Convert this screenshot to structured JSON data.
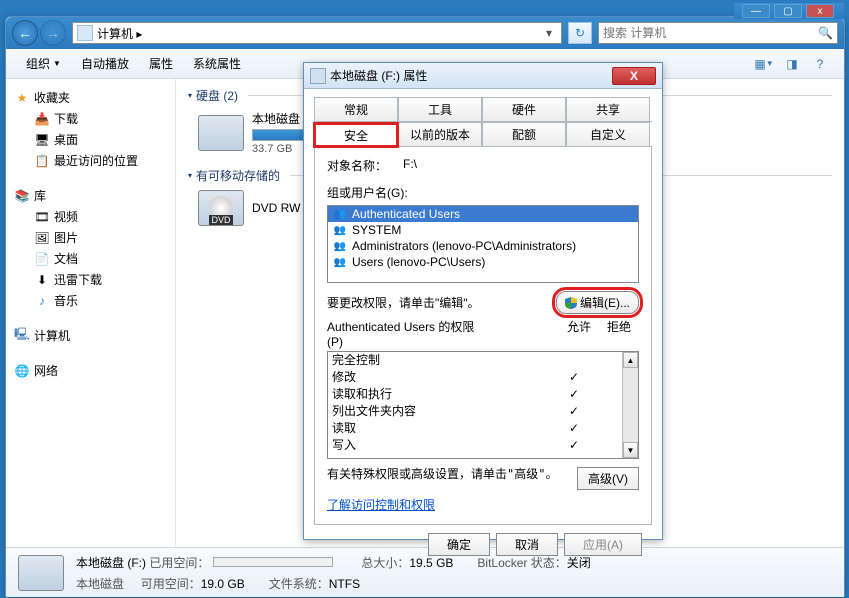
{
  "sys": {
    "min": "—",
    "max": "▢",
    "close": "x"
  },
  "nav": {
    "back": "←",
    "fwd": "→"
  },
  "address": {
    "text": "计算机 ▸",
    "dd": "▾",
    "refresh": "↻"
  },
  "search": {
    "placeholder": "搜索 计算机",
    "icon": "🔍"
  },
  "toolbar": {
    "organize": "组织",
    "autoplay": "自动播放",
    "props": "属性",
    "sysprops": "系统属性"
  },
  "sidebar": {
    "fav": {
      "label": "收藏夹",
      "items": [
        "下载",
        "桌面",
        "最近访问的位置"
      ]
    },
    "lib": {
      "label": "库",
      "items": [
        "视频",
        "图片",
        "文档",
        "迅雷下载",
        "音乐"
      ]
    },
    "computer": "计算机",
    "network": "网络"
  },
  "main": {
    "hdd_section": "硬盘 (2)",
    "removable_section": "有可移动存储的",
    "drive1": {
      "name": "本地磁盘",
      "size": "33.7 GB"
    },
    "dvd": {
      "name": "DVD RW 驱"
    }
  },
  "statusbar": {
    "title": "本地磁盘 (F:)",
    "subtitle": "本地磁盘",
    "used_label": "已用空间：",
    "free_label": "可用空间：",
    "free_val": "19.0 GB",
    "total_label": "总大小：",
    "total_val": "19.5 GB",
    "fs_label": "文件系统：",
    "fs_val": "NTFS",
    "bl_label": "BitLocker 状态：",
    "bl_val": "关闭"
  },
  "props": {
    "title": "本地磁盘 (F:) 属性",
    "tabs_row1": [
      "常规",
      "工具",
      "硬件",
      "共享"
    ],
    "tabs_row2": [
      "安全",
      "以前的版本",
      "配额",
      "自定义"
    ],
    "object_label": "对象名称：",
    "object_value": "F:\\",
    "group_label": "组或用户名(G):",
    "users": [
      "Authenticated Users",
      "SYSTEM",
      "Administrators (lenovo-PC\\Administrators)",
      "Users (lenovo-PC\\Users)"
    ],
    "edit_text": "要更改权限，请单击\"编辑\"。",
    "edit_btn": "编辑(E)...",
    "perm_label_l1": "Authenticated Users 的权限",
    "perm_label_l2": "(P)",
    "allow_label": "允许",
    "deny_label": "拒绝",
    "perms": [
      {
        "name": "完全控制",
        "allow": false
      },
      {
        "name": "修改",
        "allow": true
      },
      {
        "name": "读取和执行",
        "allow": true
      },
      {
        "name": "列出文件夹内容",
        "allow": true
      },
      {
        "name": "读取",
        "allow": true
      },
      {
        "name": "写入",
        "allow": true
      }
    ],
    "adv_text": "有关特殊权限或高级设置，请单击\"高级\"。",
    "adv_btn": "高级(V)",
    "link": "了解访问控制和权限",
    "ok": "确定",
    "cancel": "取消",
    "apply": "应用(A)"
  }
}
